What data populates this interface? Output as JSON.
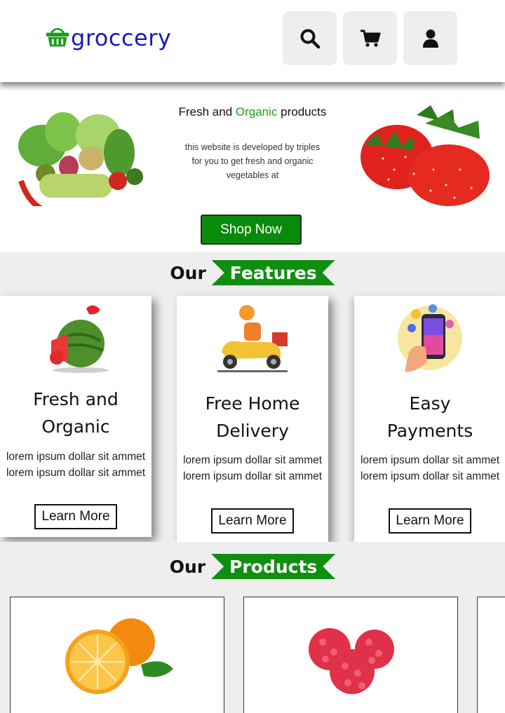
{
  "header": {
    "logo_text": "groccery",
    "logo_icon": "basket-icon",
    "buttons": [
      {
        "icon": "search-icon"
      },
      {
        "icon": "cart-icon"
      },
      {
        "icon": "user-icon"
      }
    ]
  },
  "hero": {
    "title_part1": "Fresh and ",
    "title_highlight": "Organic",
    "title_part2": " products",
    "description": "this website is developed by triples for you to get fresh and organic vegetables at",
    "cta_label": "Shop Now"
  },
  "features": {
    "heading_prefix": "Our",
    "heading_highlight": "Features",
    "cards": [
      {
        "icon": "watermelon-icon",
        "title": "Fresh and Organic",
        "description": "lorem ipsum dollar sit ammet lorem ipsum dollar sit ammet",
        "button_label": "Learn More"
      },
      {
        "icon": "delivery-scooter-icon",
        "title": "Free Home Delivery",
        "description": "lorem ipsum dollar sit ammet lorem ipsum dollar sit ammet",
        "button_label": "Learn More"
      },
      {
        "icon": "phone-payment-icon",
        "title": "Easy Payments",
        "description": "lorem ipsum dollar sit ammet lorem ipsum dollar sit ammet",
        "button_label": "Learn More"
      }
    ]
  },
  "products": {
    "heading_prefix": "Our",
    "heading_highlight": "Products",
    "items": [
      {
        "image": "orange-icon"
      },
      {
        "image": "raspberry-icon"
      },
      {
        "image": "product-image"
      }
    ]
  },
  "colors": {
    "accent_green": "#0f8f0f",
    "logo_blue": "#1a1ab8",
    "band_gray": "#eeeeee"
  }
}
